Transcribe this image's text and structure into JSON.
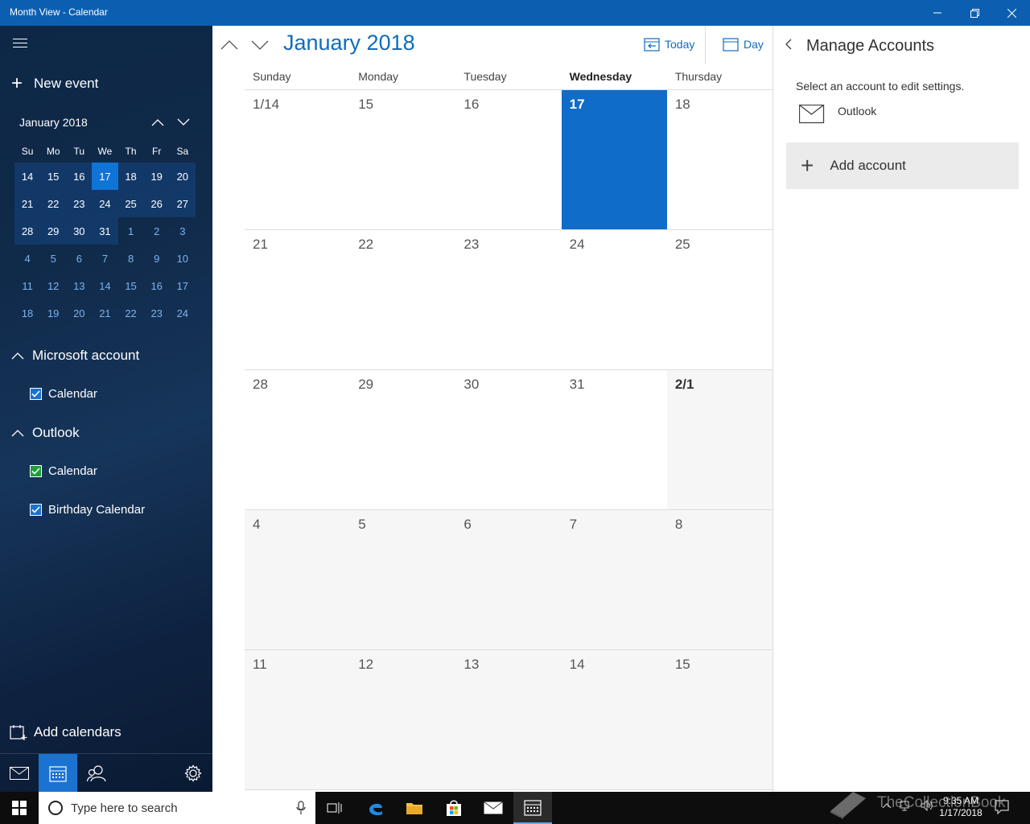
{
  "window": {
    "title": "Month View - Calendar"
  },
  "sidebar": {
    "new_event": "New event",
    "mini_calendar": {
      "title": "January 2018",
      "dow": [
        "Su",
        "Mo",
        "Tu",
        "We",
        "Th",
        "Fr",
        "Sa"
      ],
      "weeks": [
        [
          {
            "d": "14",
            "in": true
          },
          {
            "d": "15",
            "in": true
          },
          {
            "d": "16",
            "in": true
          },
          {
            "d": "17",
            "in": true,
            "today": true
          },
          {
            "d": "18",
            "in": true
          },
          {
            "d": "19",
            "in": true
          },
          {
            "d": "20",
            "in": true
          }
        ],
        [
          {
            "d": "21",
            "in": true
          },
          {
            "d": "22",
            "in": true
          },
          {
            "d": "23",
            "in": true
          },
          {
            "d": "24",
            "in": true
          },
          {
            "d": "25",
            "in": true
          },
          {
            "d": "26",
            "in": true
          },
          {
            "d": "27",
            "in": true
          }
        ],
        [
          {
            "d": "28",
            "in": true
          },
          {
            "d": "29",
            "in": true
          },
          {
            "d": "30",
            "in": true
          },
          {
            "d": "31",
            "in": true
          },
          {
            "d": "1"
          },
          {
            "d": "2"
          },
          {
            "d": "3"
          }
        ],
        [
          {
            "d": "4"
          },
          {
            "d": "5"
          },
          {
            "d": "6"
          },
          {
            "d": "7"
          },
          {
            "d": "8"
          },
          {
            "d": "9"
          },
          {
            "d": "10"
          }
        ],
        [
          {
            "d": "11"
          },
          {
            "d": "12"
          },
          {
            "d": "13"
          },
          {
            "d": "14"
          },
          {
            "d": "15"
          },
          {
            "d": "16"
          },
          {
            "d": "17"
          }
        ],
        [
          {
            "d": "18"
          },
          {
            "d": "19"
          },
          {
            "d": "20"
          },
          {
            "d": "21"
          },
          {
            "d": "22"
          },
          {
            "d": "23"
          },
          {
            "d": "24"
          }
        ]
      ]
    },
    "groups": [
      {
        "name": "Microsoft account",
        "calendars": [
          {
            "label": "Calendar",
            "color": "#1a73d1",
            "checked": true
          }
        ]
      },
      {
        "name": "Outlook",
        "calendars": [
          {
            "label": "Calendar",
            "color": "#1e9e3a",
            "checked": true
          },
          {
            "label": "Birthday Calendar",
            "color": "#1a73d1",
            "checked": true
          }
        ]
      }
    ],
    "add_calendars": "Add calendars"
  },
  "main": {
    "month_title": "January 2018",
    "today_label": "Today",
    "view_label": "Day",
    "dow": [
      "Sunday",
      "Monday",
      "Tuesday",
      "Wednesday",
      "Thursday"
    ],
    "today_col": 3,
    "weeks": [
      [
        {
          "d": "1/14"
        },
        {
          "d": "15"
        },
        {
          "d": "16"
        },
        {
          "d": "17",
          "today": true
        },
        {
          "d": "18"
        }
      ],
      [
        {
          "d": "21"
        },
        {
          "d": "22"
        },
        {
          "d": "23"
        },
        {
          "d": "24"
        },
        {
          "d": "25"
        }
      ],
      [
        {
          "d": "28"
        },
        {
          "d": "29"
        },
        {
          "d": "30"
        },
        {
          "d": "31"
        },
        {
          "d": "2/1",
          "out": true,
          "bold": true
        }
      ],
      [
        {
          "d": "4",
          "out": true
        },
        {
          "d": "5",
          "out": true
        },
        {
          "d": "6",
          "out": true
        },
        {
          "d": "7",
          "out": true
        },
        {
          "d": "8",
          "out": true
        }
      ],
      [
        {
          "d": "11",
          "out": true
        },
        {
          "d": "12",
          "out": true
        },
        {
          "d": "13",
          "out": true
        },
        {
          "d": "14",
          "out": true
        },
        {
          "d": "15",
          "out": true
        }
      ]
    ]
  },
  "manage_accounts": {
    "title": "Manage Accounts",
    "subtitle": "Select an account to edit settings.",
    "account_name": "Outlook",
    "add_account": "Add account"
  },
  "taskbar": {
    "search_placeholder": "Type here to search",
    "time": "9:35 AM",
    "date": "1/17/2018"
  },
  "watermark": "TheCollectionBook",
  "colors": {
    "accent": "#0f6cbd",
    "titlebar": "#0c5fb0",
    "today": "#0f6cc9"
  }
}
